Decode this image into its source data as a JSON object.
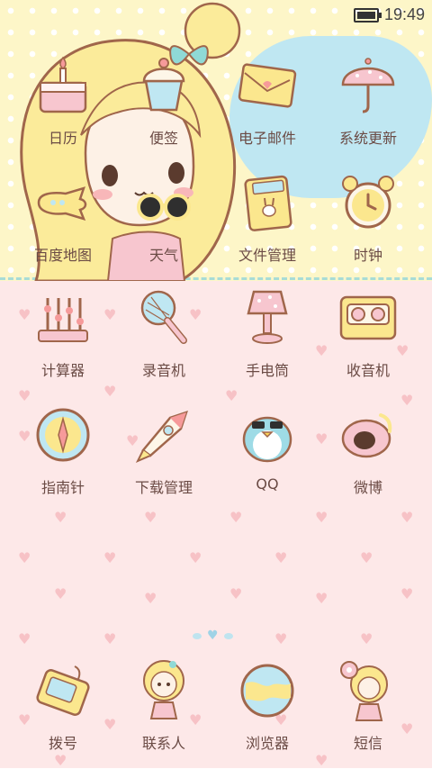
{
  "status_bar": {
    "time": "19:49",
    "battery_icon": "battery-icon"
  },
  "colors": {
    "top_bg": "#fdf6c8",
    "bottom_bg": "#fde8e8",
    "label": "#6b4b45",
    "divider": "#a8dcd6"
  },
  "apps": [
    {
      "label": "日历",
      "icon": "calendar-cake-icon"
    },
    {
      "label": "便签",
      "icon": "notes-cupcake-icon"
    },
    {
      "label": "电子邮件",
      "icon": "email-envelope-icon"
    },
    {
      "label": "系统更新",
      "icon": "umbrella-icon"
    },
    {
      "label": "百度地图",
      "icon": "map-plane-icon"
    },
    {
      "label": "天气",
      "icon": "weather-sunglasses-icon"
    },
    {
      "label": "文件管理",
      "icon": "file-book-icon"
    },
    {
      "label": "时钟",
      "icon": "alarm-clock-icon"
    },
    {
      "label": "计算器",
      "icon": "abacus-icon"
    },
    {
      "label": "录音机",
      "icon": "microphone-icon"
    },
    {
      "label": "手电筒",
      "icon": "lamp-icon"
    },
    {
      "label": "收音机",
      "icon": "cassette-icon"
    },
    {
      "label": "指南针",
      "icon": "compass-icon"
    },
    {
      "label": "下载管理",
      "icon": "rocket-icon"
    },
    {
      "label": "QQ",
      "icon": "penguin-icon"
    },
    {
      "label": "微博",
      "icon": "weibo-icon"
    }
  ],
  "dock": [
    {
      "label": "拨号",
      "icon": "phone-icon"
    },
    {
      "label": "联系人",
      "icon": "contacts-girl-icon"
    },
    {
      "label": "浏览器",
      "icon": "globe-icon"
    },
    {
      "label": "短信",
      "icon": "messages-girl-icon"
    }
  ]
}
